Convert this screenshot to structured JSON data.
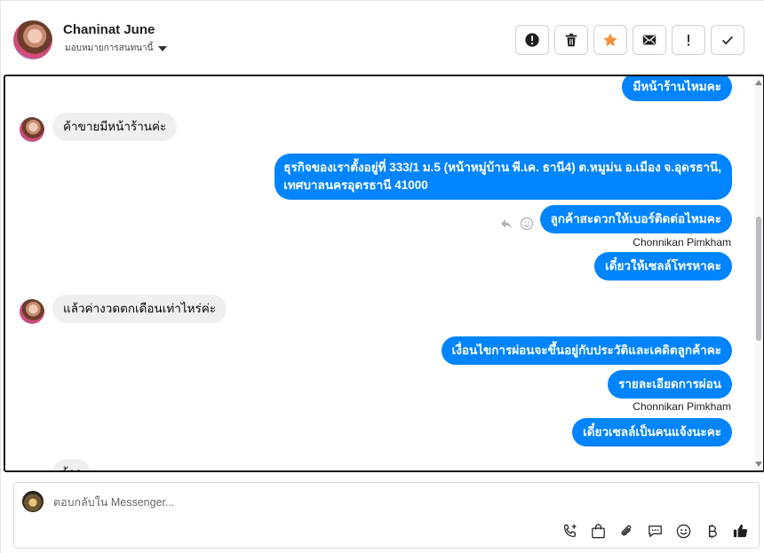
{
  "header": {
    "contact_name": "Chaninat June",
    "assign_label": "มอบหมายการสนทนานี้",
    "actions": [
      {
        "name": "report-spam-button",
        "icon": "alert-icon"
      },
      {
        "name": "delete-button",
        "icon": "trash-icon"
      },
      {
        "name": "star-button",
        "icon": "star-icon"
      },
      {
        "name": "mark-unread-button",
        "icon": "envelope-icon"
      },
      {
        "name": "follow-up-button",
        "icon": "exclamation-icon"
      },
      {
        "name": "mark-done-button",
        "icon": "check-icon"
      }
    ]
  },
  "messages": {
    "m1": "มีหน้าร้านไหมคะ",
    "m2": "ค้าขายมีหน้าร้านค่ะ",
    "m3_line1": "ธุรกิจของเราตั้งอยู่ที่ 333/1 ม.5 (หน้าหมู่บ้าน พี.เค. ธานี4) ต.หมูม่น อ.เมือง จ.อุดรธานี,",
    "m3_line2": "เทศบาลนครอุดรธานี 41000",
    "m4": "ลูกค้าสะดวกให้เบอร์ติดต่อไหมคะ",
    "sender1": "Chonnikan Pimkham",
    "m5": "เดี๋ยวให้เซลล์โทรหาคะ",
    "m6": "แล้วค่างวดตกเดือนเท่าไหร่ค่ะ",
    "m7": "เงื่อนไขการผ่อนจะขึ้นอยู่กับประวัติและเคดิตลูกค้าคะ",
    "m8": "รายละเอียดการผ่อน",
    "sender2": "Chonnikan Pimkham",
    "m9": "เดี๋ยวเซลล์เป็นคนแจ้งนะคะ",
    "m10_partial": "อ้าว"
  },
  "composer": {
    "placeholder": "ตอบกลับใน Messenger...",
    "tools": [
      "phone-add-icon",
      "shopping-bag-icon",
      "paperclip-icon",
      "saved-reply-icon",
      "emoji-icon",
      "baht-icon",
      "thumbs-up-icon"
    ]
  },
  "colors": {
    "outgoing_bubble": "#0084ff",
    "incoming_bubble": "#eeeff1",
    "star_accent": "#f5923e"
  }
}
